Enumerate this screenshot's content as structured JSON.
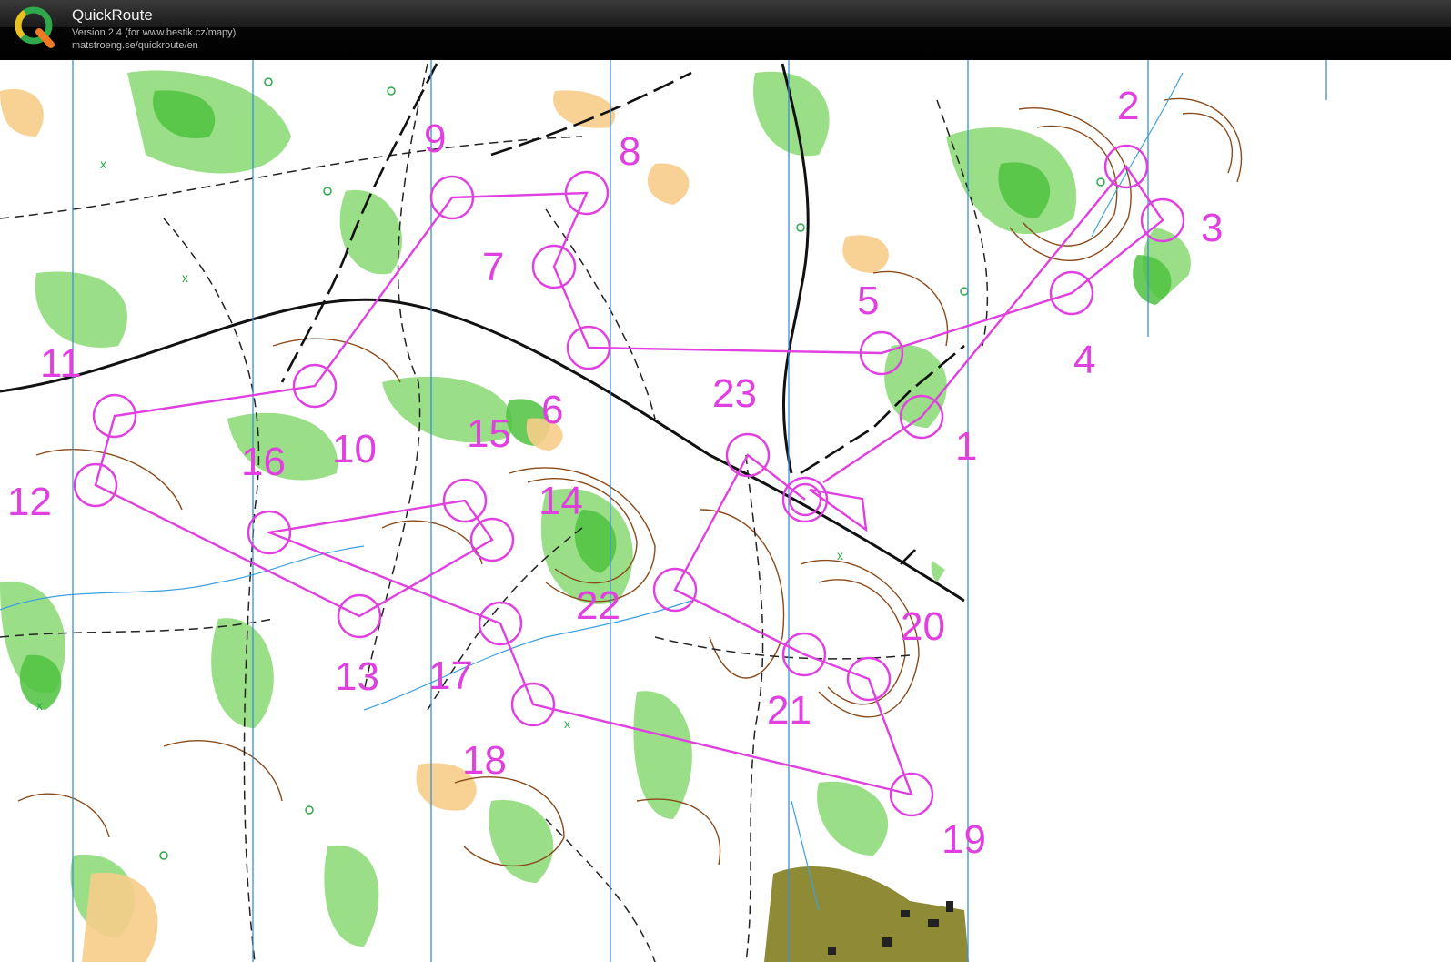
{
  "app": {
    "title": "QuickRoute",
    "version": "Version 2.4  (for www.bestik.cz/mapy)",
    "url": "matstroeng.se/quickroute/en",
    "logo_letter": "Q"
  },
  "map": {
    "course_color": "#e040e0",
    "meridian_color": "#3b8fd6",
    "contour_color": "#8a4a1a",
    "vegetation_color": "#66cc55",
    "open_color": "#f7cd8a",
    "controls": [
      {
        "number": "1"
      },
      {
        "number": "2"
      },
      {
        "number": "3"
      },
      {
        "number": "4"
      },
      {
        "number": "5"
      },
      {
        "number": "6"
      },
      {
        "number": "7"
      },
      {
        "number": "8"
      },
      {
        "number": "9"
      },
      {
        "number": "10"
      },
      {
        "number": "11"
      },
      {
        "number": "12"
      },
      {
        "number": "13"
      },
      {
        "number": "14"
      },
      {
        "number": "15"
      },
      {
        "number": "16"
      },
      {
        "number": "17"
      },
      {
        "number": "18"
      },
      {
        "number": "19"
      },
      {
        "number": "20"
      },
      {
        "number": "21"
      },
      {
        "number": "22"
      },
      {
        "number": "23"
      }
    ]
  }
}
